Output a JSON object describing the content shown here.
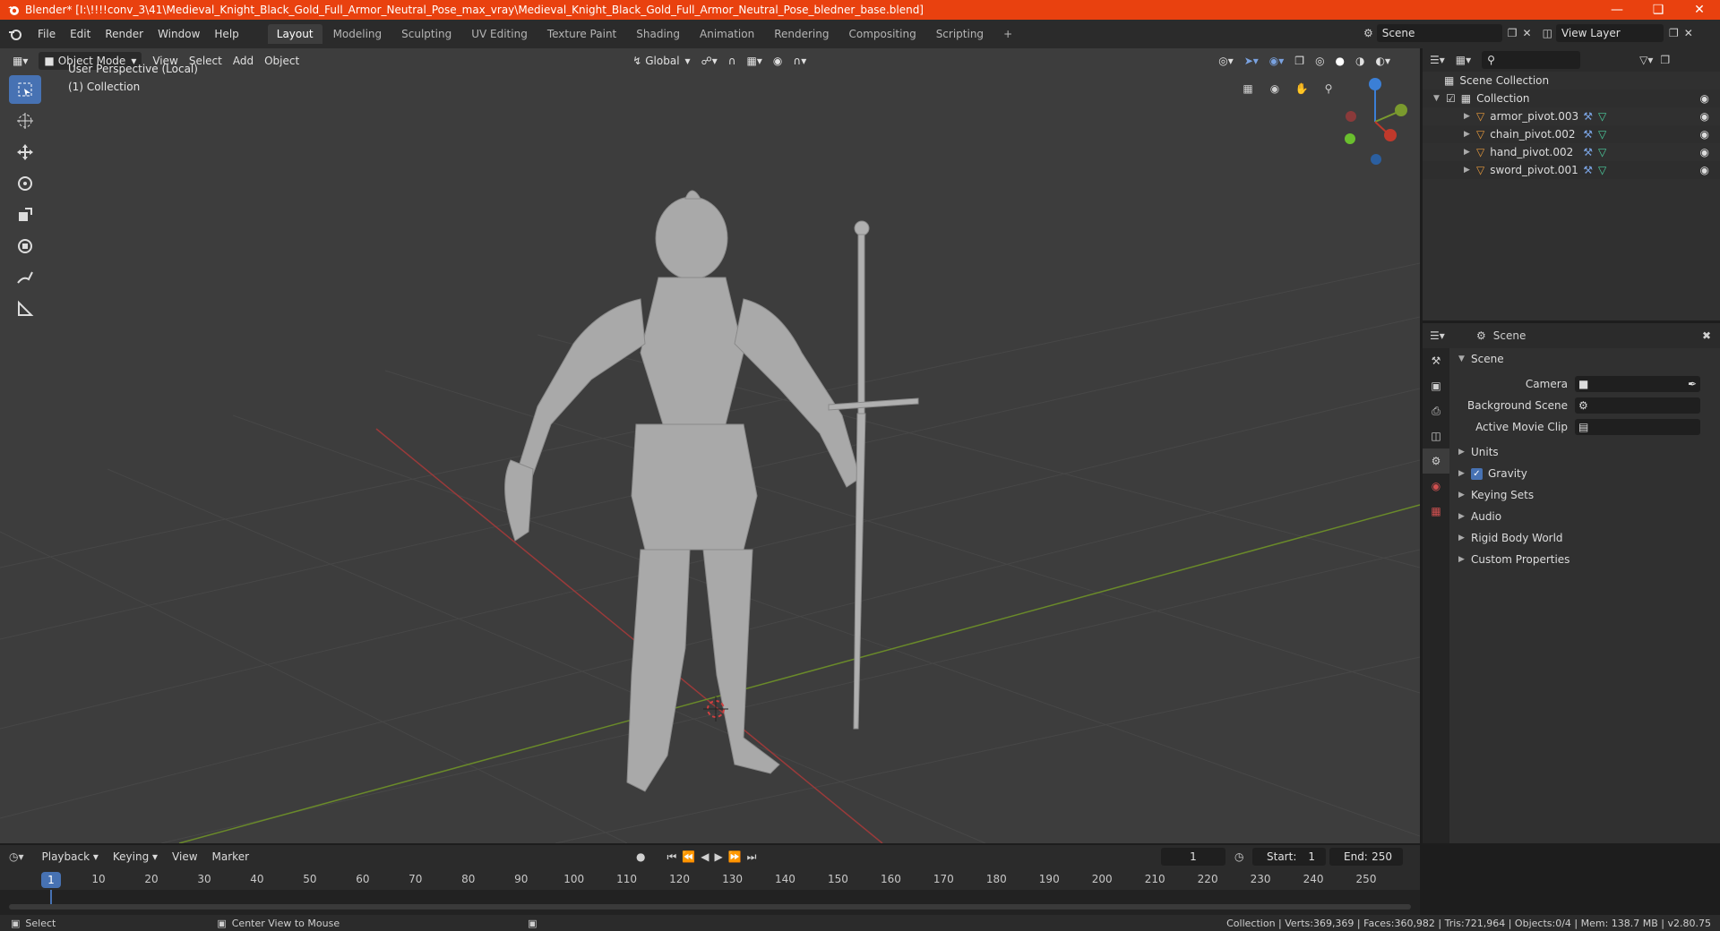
{
  "window": {
    "title": "Blender* [I:\\!!!!conv_3\\41\\Medieval_Knight_Black_Gold_Full_Armor_Neutral_Pose_max_vray\\Medieval_Knight_Black_Gold_Full_Armor_Neutral_Pose_bledner_base.blend]"
  },
  "menu": [
    "File",
    "Edit",
    "Render",
    "Window",
    "Help"
  ],
  "workspaces": [
    "Layout",
    "Modeling",
    "Sculpting",
    "UV Editing",
    "Texture Paint",
    "Shading",
    "Animation",
    "Rendering",
    "Compositing",
    "Scripting"
  ],
  "active_workspace": "Layout",
  "scene_name": "Scene",
  "view_layer": "View Layer",
  "viewport": {
    "mode": "Object Mode",
    "menus": [
      "View",
      "Select",
      "Add",
      "Object"
    ],
    "transform_orientation": "Global",
    "perspective_label": "User Perspective (Local)",
    "collection_label": "(1) Collection"
  },
  "outliner": {
    "root": "Scene Collection",
    "collection": "Collection",
    "objects": [
      "armor_pivot.003",
      "chain_pivot.002",
      "hand_pivot.002",
      "sword_pivot.001"
    ]
  },
  "properties": {
    "header": "Scene",
    "panel": "Scene",
    "fields": [
      {
        "label": "Camera"
      },
      {
        "label": "Background Scene"
      },
      {
        "label": "Active Movie Clip"
      }
    ],
    "sections": [
      "Units",
      "Gravity",
      "Keying Sets",
      "Audio",
      "Rigid Body World",
      "Custom Properties"
    ],
    "gravity_checked": true
  },
  "timeline": {
    "menus": [
      "Playback",
      "Keying",
      "View",
      "Marker"
    ],
    "current_frame": "1",
    "start_label": "Start:",
    "start": "1",
    "end_label": "End:",
    "end": "250",
    "ticks": [
      "1",
      "10",
      "20",
      "30",
      "40",
      "50",
      "60",
      "70",
      "80",
      "90",
      "100",
      "110",
      "120",
      "130",
      "140",
      "150",
      "160",
      "170",
      "180",
      "190",
      "200",
      "210",
      "220",
      "230",
      "240",
      "250"
    ]
  },
  "status": {
    "left_action": "Select",
    "middle_action": "Center View to Mouse",
    "stats": "Collection | Verts:369,369 | Faces:360,982 | Tris:721,964 | Objects:0/4 | Mem: 138.7 MB | v2.80.75"
  },
  "colors": {
    "accent": "#4772b3",
    "titlebar": "#e9410f",
    "x_axis": "#c0392b",
    "y_axis": "#7a9a2e",
    "z_axis": "#3b7fd6"
  }
}
